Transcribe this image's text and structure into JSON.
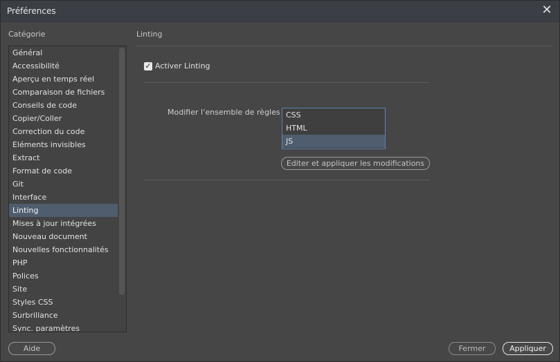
{
  "window": {
    "title": "Préférences",
    "close_glyph": "✕"
  },
  "sidebar": {
    "label": "Catégorie",
    "selected": "Linting",
    "items": [
      "Général",
      "Accessibilité",
      "Aperçu en temps réel",
      "Comparaison de fichiers",
      "Conseils de code",
      "Copier/Coller",
      "Correction du code",
      "Eléments invisibles",
      "Extract",
      "Format de code",
      "Git",
      "Interface",
      "Linting",
      "Mises à jour intégrées",
      "Nouveau document",
      "Nouvelles fonctionnalités",
      "PHP",
      "Polices",
      "Site",
      "Styles CSS",
      "Surbrillance",
      "Sync. paramètres"
    ]
  },
  "main": {
    "section_title": "Linting",
    "enable_checkbox": {
      "label": "Activer Linting",
      "checked": true
    },
    "ruleset": {
      "label": "Modifier l’ensemble de règles :",
      "options": [
        "CSS",
        "HTML",
        "JS"
      ],
      "selected": "JS"
    },
    "edit_button": "Editer et appliquer les modifications"
  },
  "footer": {
    "help": "Aide",
    "cancel": "Fermer",
    "apply": "Appliquer"
  },
  "colors": {
    "selection": "#4f5d6e",
    "listbox_border": "#5f82ad",
    "background": "#464646"
  }
}
